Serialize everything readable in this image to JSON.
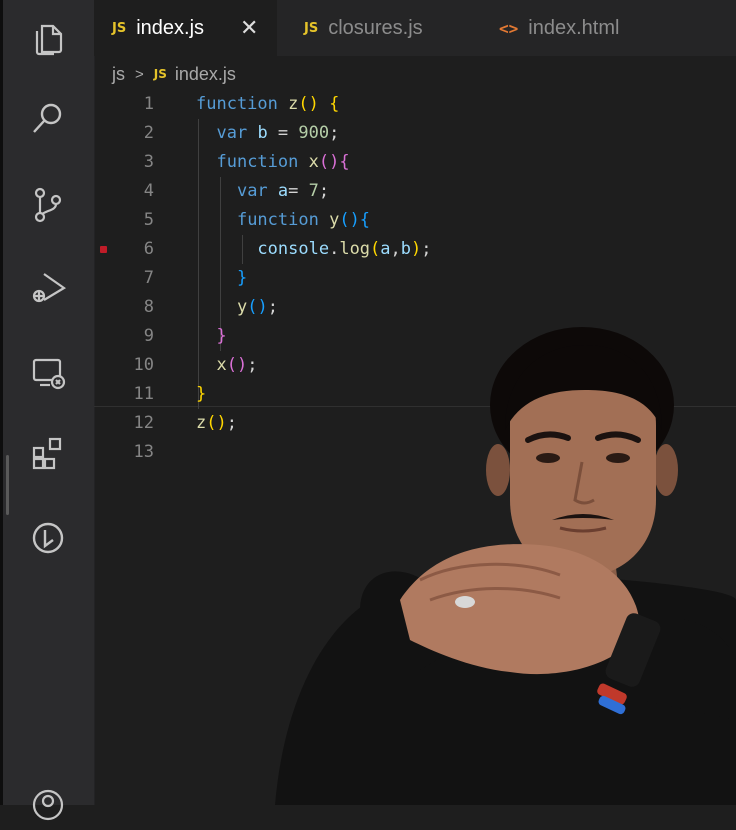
{
  "tabs": [
    {
      "badge": "JS",
      "label": "index.js",
      "close": "✕",
      "active": true
    },
    {
      "badge": "JS",
      "label": "closures.js",
      "active": false
    },
    {
      "badge": "<>",
      "label": "index.html",
      "active": false
    }
  ],
  "breadcrumb": {
    "folder": "js",
    "separator": ">",
    "badge": "JS",
    "file": "index.js"
  },
  "activity_icons": [
    "explorer-icon",
    "search-icon",
    "source-control-icon",
    "run-debug-icon",
    "remote-explorer-icon",
    "extensions-icon",
    "timeline-icon",
    "accounts-icon"
  ],
  "code": {
    "lines": [
      {
        "n": "1",
        "tokens": [
          [
            "kw",
            "function "
          ],
          [
            "fn",
            "z"
          ],
          [
            "p1",
            "()"
          ],
          [
            "op",
            " "
          ],
          [
            "p1",
            "{"
          ]
        ]
      },
      {
        "n": "2",
        "tokens": [
          [
            "op",
            "  "
          ],
          [
            "kw",
            "var "
          ],
          [
            "var",
            "b"
          ],
          [
            "op",
            " = "
          ],
          [
            "num",
            "900"
          ],
          [
            "op",
            ";"
          ]
        ]
      },
      {
        "n": "3",
        "tokens": [
          [
            "op",
            "  "
          ],
          [
            "kw",
            "function "
          ],
          [
            "fn",
            "x"
          ],
          [
            "p2",
            "(){"
          ]
        ]
      },
      {
        "n": "4",
        "tokens": [
          [
            "op",
            "    "
          ],
          [
            "kw",
            "var "
          ],
          [
            "var",
            "a"
          ],
          [
            "op",
            "= "
          ],
          [
            "num",
            "7"
          ],
          [
            "op",
            ";"
          ]
        ]
      },
      {
        "n": "5",
        "tokens": [
          [
            "op",
            "    "
          ],
          [
            "kw",
            "function "
          ],
          [
            "fn",
            "y"
          ],
          [
            "p3",
            "(){"
          ]
        ]
      },
      {
        "n": "6",
        "tokens": [
          [
            "op",
            "      "
          ],
          [
            "var",
            "console"
          ],
          [
            "op",
            "."
          ],
          [
            "fn",
            "log"
          ],
          [
            "p1",
            "("
          ],
          [
            "var",
            "a"
          ],
          [
            "op",
            ","
          ],
          [
            "var",
            "b"
          ],
          [
            "p1",
            ")"
          ],
          [
            "op",
            ";"
          ]
        ],
        "breakpoint": true
      },
      {
        "n": "7",
        "tokens": [
          [
            "op",
            "    "
          ],
          [
            "p3",
            "}"
          ]
        ]
      },
      {
        "n": "8",
        "tokens": [
          [
            "op",
            "    "
          ],
          [
            "fn",
            "y"
          ],
          [
            "p3",
            "()"
          ],
          [
            "op",
            ";"
          ]
        ]
      },
      {
        "n": "9",
        "tokens": [
          [
            "op",
            "  "
          ],
          [
            "p2",
            "}"
          ]
        ]
      },
      {
        "n": "10",
        "tokens": [
          [
            "op",
            "  "
          ],
          [
            "fn",
            "x"
          ],
          [
            "p2",
            "()"
          ],
          [
            "op",
            ";"
          ]
        ]
      },
      {
        "n": "11",
        "tokens": [
          [
            "p1",
            "}"
          ]
        ]
      },
      {
        "n": "12",
        "tokens": [
          [
            "fn",
            "z"
          ],
          [
            "p1",
            "()"
          ],
          [
            "op",
            ";"
          ]
        ]
      },
      {
        "n": "13",
        "tokens": []
      }
    ]
  },
  "colors": {
    "breakpoint": "#c01c28",
    "js_badge": "#e5c32a",
    "html_badge": "#e37933"
  }
}
